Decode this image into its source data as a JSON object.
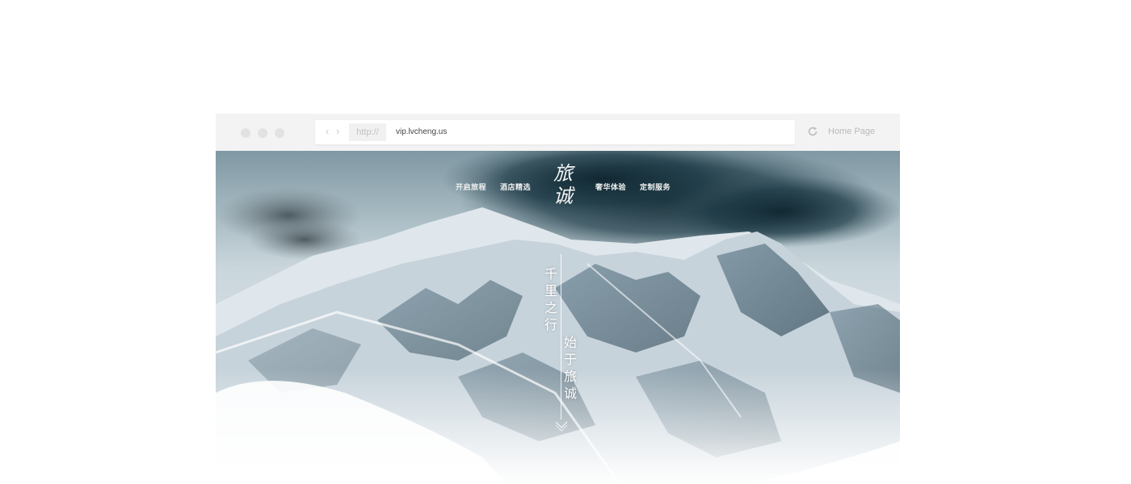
{
  "browser": {
    "url_protocol": "http://",
    "url": "vip.lvcheng.us",
    "home_label": "Home Page",
    "back_icon": "chevron-left-icon",
    "forward_icon": "chevron-right-icon",
    "reload_icon": "reload-icon"
  },
  "site": {
    "logo_text": "旅诚",
    "nav": [
      "开启旅程",
      "酒店精选",
      "奢华体验",
      "定制服务"
    ],
    "slogan_line1": "千里之行",
    "slogan_line2": "始于旅诚",
    "scroll_icon": "chevron-down-icon"
  },
  "colors": {
    "chrome_bg": "#f3f3f3",
    "sky_dark": "#1c3540",
    "snow": "#e8eef2"
  }
}
